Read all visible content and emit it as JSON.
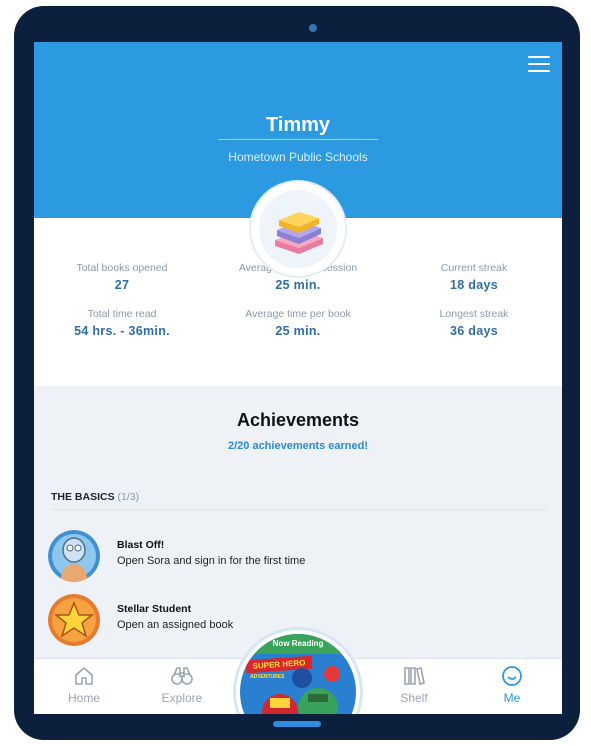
{
  "profile": {
    "name": "Timmy",
    "school": "Hometown Public Schools"
  },
  "stats": [
    {
      "label": "Total books opened",
      "value": "27"
    },
    {
      "label": "Average time per session",
      "value": "25 min."
    },
    {
      "label": "Current streak",
      "value": "18 days"
    },
    {
      "label": "Total time read",
      "value": "54 hrs. - 36min."
    },
    {
      "label": "Average time per book",
      "value": "25 min."
    },
    {
      "label": "Longest streak",
      "value": "36 days"
    }
  ],
  "achievements": {
    "title": "Achievements",
    "earned": "2/20 achievements earned!",
    "section": {
      "title": "THE BASICS",
      "count": "(1/3)"
    },
    "items": [
      {
        "name": "Blast Off!",
        "description": "Open Sora and sign in for the first time"
      },
      {
        "name": "Stellar Student",
        "description": "Open an assigned book"
      }
    ]
  },
  "nav": {
    "items": [
      {
        "label": "Home",
        "icon": "home-icon"
      },
      {
        "label": "Explore",
        "icon": "binoculars-icon"
      },
      {
        "label": "Shelf",
        "icon": "bookshelf-icon"
      },
      {
        "label": "Me",
        "icon": "smiley-icon"
      }
    ],
    "active": "Me",
    "now_reading": {
      "banner": "Now Reading",
      "cover_title": "SUPER HERO",
      "cover_subtitle": "ADVENTURES"
    }
  },
  "colors": {
    "header": "#2b9ae0",
    "accent": "#2f6da8",
    "active_nav": "#2b9ae0",
    "frame": "#0c1f3d"
  }
}
